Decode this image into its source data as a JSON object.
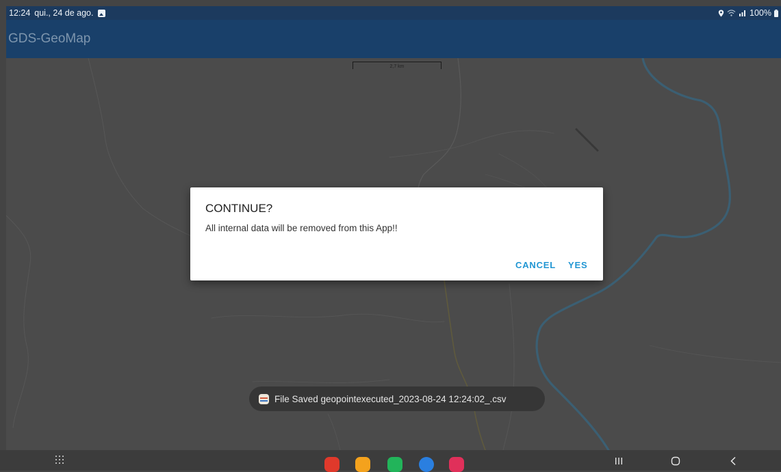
{
  "status_bar": {
    "time": "12:24",
    "date": "qui., 24 de ago.",
    "battery": "100%"
  },
  "app_bar": {
    "title": "GDS-GeoMap"
  },
  "map": {
    "scale_label": "2,7 km"
  },
  "dialog": {
    "title": "CONTINUE?",
    "message": "All internal data will be removed from this App!!",
    "cancel_label": "CANCEL",
    "yes_label": "YES"
  },
  "toast": {
    "message": "File Saved geopointexecuted_2023-08-24 12:24:02_.csv"
  },
  "nav_bar": {
    "dock_apps": [
      {
        "icon": "app-red-icon",
        "color": "#e0392b"
      },
      {
        "icon": "folder-icon",
        "color": "#f4a21d"
      },
      {
        "icon": "phone-icon",
        "color": "#22b45a"
      },
      {
        "icon": "messages-icon",
        "color": "#2a7fe0"
      },
      {
        "icon": "camera-icon",
        "color": "#e0305a"
      }
    ]
  },
  "colors": {
    "app_bar": "#19406a",
    "status_bar": "#1c3a5e",
    "accent": "#2196d3"
  }
}
